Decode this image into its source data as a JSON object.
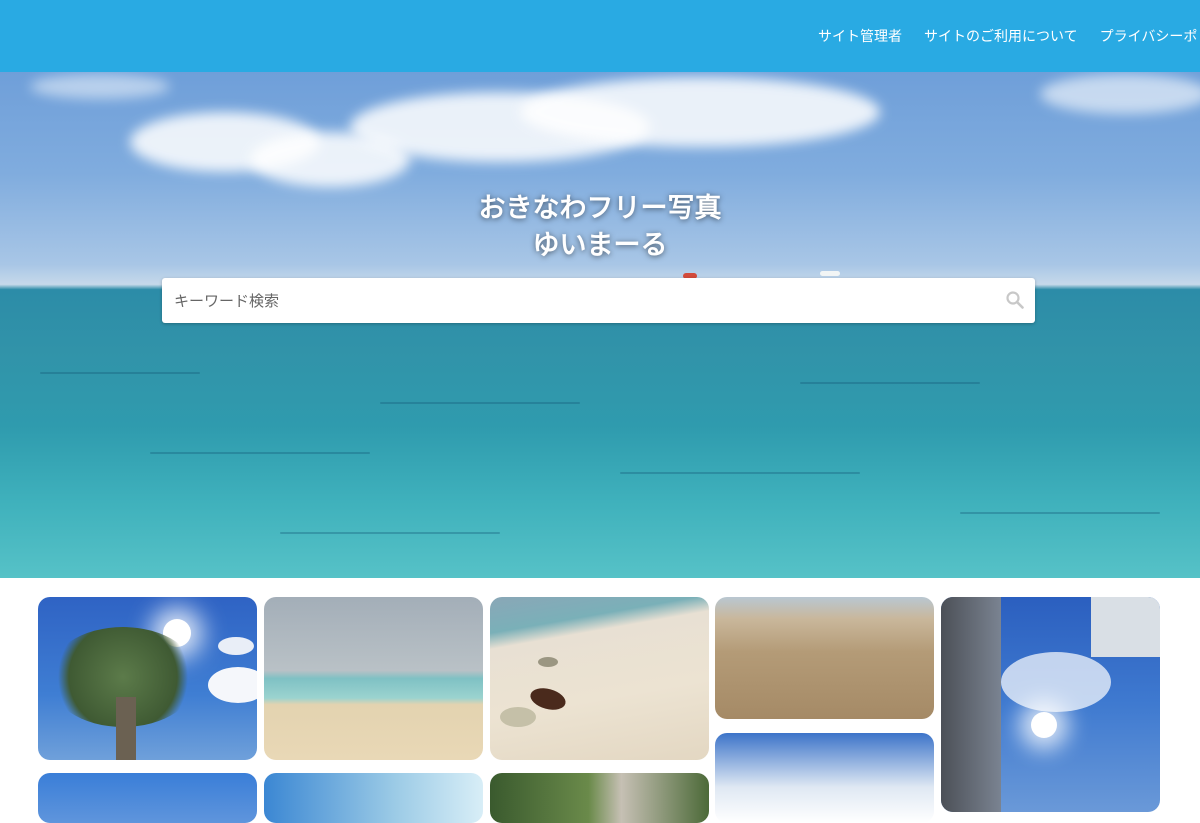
{
  "nav": {
    "items": [
      {
        "label": "サイト管理者"
      },
      {
        "label": "サイトのご利用について"
      },
      {
        "label": "プライバシーポリシー"
      }
    ]
  },
  "hero": {
    "title_line1": "おきなわフリー写真",
    "title_line2": "ゆいまーる"
  },
  "search": {
    "placeholder": "キーワード検索",
    "icon": "search-icon"
  },
  "gallery": {
    "photos": [
      {
        "subject": "palm-tree-sun-sky"
      },
      {
        "subject": "beach-shoreline"
      },
      {
        "subject": "beach-sand-shell"
      },
      {
        "subject": "rocky-coast"
      },
      {
        "subject": "sky-building-powerlines"
      },
      {
        "subject": "sky-clouds"
      },
      {
        "subject": "sky"
      },
      {
        "subject": "sky-sea"
      },
      {
        "subject": "greenery-rock"
      }
    ]
  },
  "colors": {
    "header_bg": "#29aae3",
    "text_on_header": "#ffffff"
  }
}
